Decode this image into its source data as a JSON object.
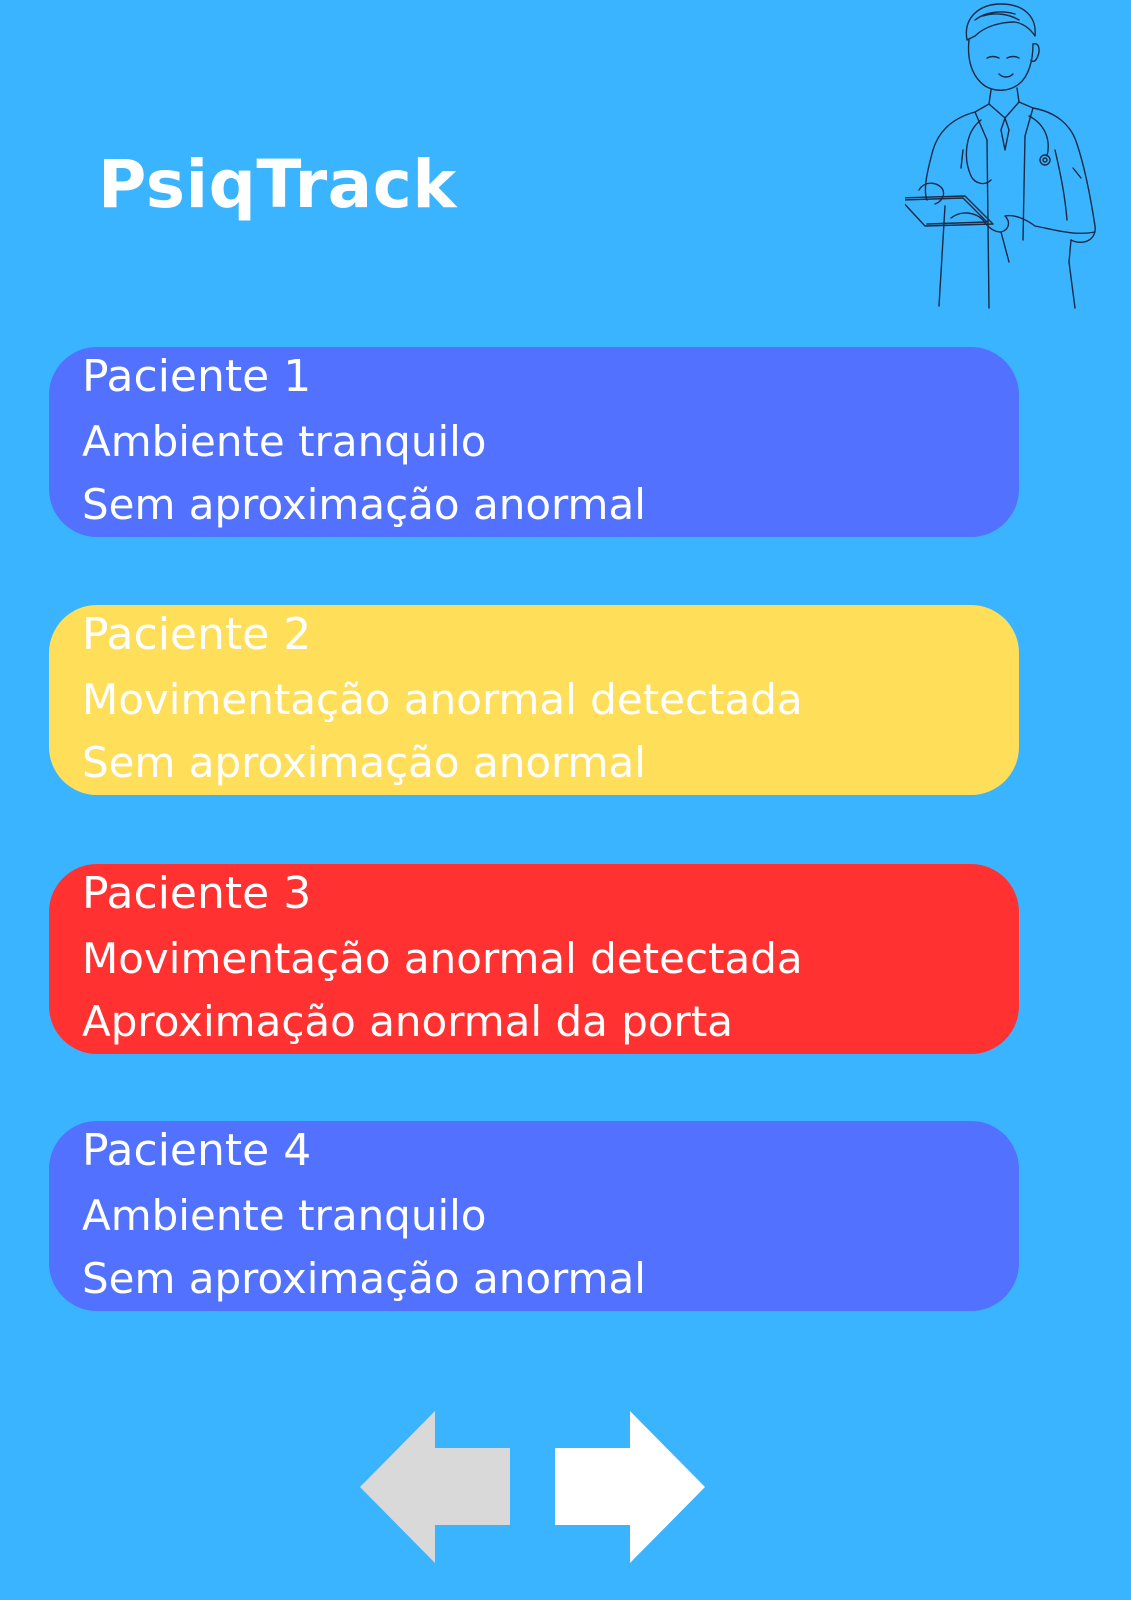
{
  "app": {
    "title": "PsiqTrack"
  },
  "illustration": {
    "icon": "doctor-with-tablet-icon"
  },
  "patients": [
    {
      "name": "Paciente 1",
      "movement": "Ambiente tranquilo",
      "approach": "Sem aproximação anormal",
      "status_color": "#5271FF"
    },
    {
      "name": "Paciente 2",
      "movement": "Movimentação anormal detectada",
      "approach": "Sem aproximação anormal",
      "status_color": "#FFDE59"
    },
    {
      "name": "Paciente 3",
      "movement": "Movimentação anormal detectada",
      "approach": "Aproximação anormal da porta",
      "status_color": "#FF3131"
    },
    {
      "name": "Paciente 4",
      "movement": "Ambiente tranquilo",
      "approach": "Sem aproximação anormal",
      "status_color": "#5271FF"
    }
  ],
  "navigation": {
    "prev": {
      "icon": "arrow-left-icon",
      "color": "#D9D9D9"
    },
    "next": {
      "icon": "arrow-right-icon",
      "color": "#FFFFFF"
    }
  },
  "colors": {
    "background": "#3BB4FF",
    "text": "#FFFFFF"
  }
}
